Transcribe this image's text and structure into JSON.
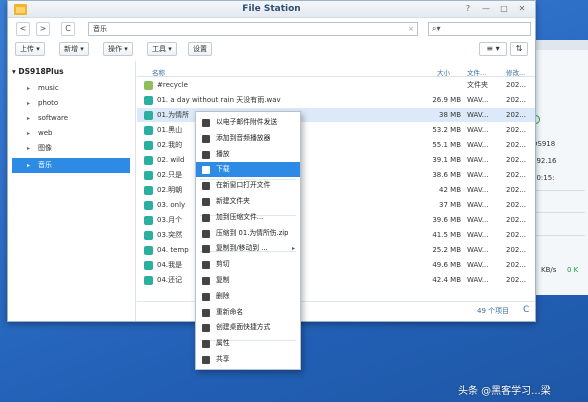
{
  "background_window": {
    "lines": [
      "DS918",
      "192.16",
      "00:15:",
      "KB/s",
      "0 K"
    ]
  },
  "window": {
    "title": "File Station",
    "controls": [
      "?",
      "—",
      "□",
      "✕"
    ]
  },
  "nav": {
    "back": "<",
    "forward": ">",
    "refresh": "C",
    "path": "音乐",
    "search_placeholder": "",
    "clear": "×"
  },
  "toolbar": {
    "upload": "上传 ▾",
    "new": "新增 ▾",
    "action": "操作 ▾",
    "tools": "工具 ▾",
    "settings": "设置",
    "view_list": "≡ ▾",
    "sort": "⇅"
  },
  "sidebar": {
    "root": "DS918Plus",
    "items": [
      {
        "label": "music",
        "arrow": "▸"
      },
      {
        "label": "photo",
        "arrow": "▸"
      },
      {
        "label": "software",
        "arrow": "▸"
      },
      {
        "label": "web",
        "arrow": "▸"
      },
      {
        "label": "图像",
        "arrow": "▸"
      },
      {
        "label": "音乐",
        "arrow": "▸"
      }
    ]
  },
  "list": {
    "columns": {
      "name": "名称",
      "size": "大小",
      "type": "文件...",
      "modified": "修改..."
    },
    "rows": [
      {
        "name": "#recycle",
        "size": "",
        "type": "文件夹",
        "modified": "202..."
      },
      {
        "name": "01. a day without rain 天没有雨.wav",
        "size": "26.9 MB",
        "type": "WAV...",
        "modified": "202..."
      },
      {
        "name": "01.为情所",
        "size": "38 MB",
        "type": "WAV...",
        "modified": "202..."
      },
      {
        "name": "01.黑山",
        "size": "53.2 MB",
        "type": "WAV...",
        "modified": "202..."
      },
      {
        "name": "02.我的",
        "size": "55.1 MB",
        "type": "WAV...",
        "modified": "202..."
      },
      {
        "name": "02. wild",
        "size": "39.1 MB",
        "type": "WAV...",
        "modified": "202..."
      },
      {
        "name": "02.只是",
        "size": "38.6 MB",
        "type": "WAV...",
        "modified": "202..."
      },
      {
        "name": "02.明朝",
        "size": "42 MB",
        "type": "WAV...",
        "modified": "202..."
      },
      {
        "name": "03. only",
        "size": "37 MB",
        "type": "WAV...",
        "modified": "202..."
      },
      {
        "name": "03.月个",
        "size": "39.6 MB",
        "type": "WAV...",
        "modified": "202..."
      },
      {
        "name": "03.突然",
        "size": "41.5 MB",
        "type": "WAV...",
        "modified": "202..."
      },
      {
        "name": "04. temp",
        "size": "25.2 MB",
        "type": "WAV...",
        "modified": "202..."
      },
      {
        "name": "04.我是",
        "size": "49.6 MB",
        "type": "WAV...",
        "modified": "202..."
      },
      {
        "name": "04.还记",
        "size": "42.4 MB",
        "type": "WAV...",
        "modified": "202..."
      }
    ],
    "count": "49 个项目",
    "refresh": "C"
  },
  "context_menu": {
    "items": [
      {
        "label": "以电子邮件附件发送",
        "icon": "mail-icon"
      },
      {
        "label": "添加到音频播放器",
        "icon": "add-to-player-icon"
      },
      {
        "label": "播放",
        "icon": "play-icon"
      },
      {
        "label": "下载",
        "icon": "download-icon",
        "highlighted": true
      },
      {
        "label": "在新窗口打开文件",
        "icon": "new-window-icon"
      },
      {
        "label": "新建文件夹",
        "icon": "new-folder-icon"
      },
      {
        "label": "加到压缩文件...",
        "icon": "archive-add-icon"
      },
      {
        "label": "压缩到 01.为情所伤.zip",
        "icon": "zip-icon"
      },
      {
        "label": "复制到/移动到 ...",
        "icon": "copy-move-icon",
        "submenu": "▸"
      },
      {
        "label": "剪切",
        "icon": "cut-icon"
      },
      {
        "label": "复制",
        "icon": "copy-icon"
      },
      {
        "label": "删除",
        "icon": "delete-icon"
      },
      {
        "label": "重新命名",
        "icon": "rename-icon"
      },
      {
        "label": "创建桌面快捷方式",
        "icon": "shortcut-icon"
      },
      {
        "label": "属性",
        "icon": "info-icon"
      },
      {
        "label": "共享",
        "icon": "share-icon"
      }
    ]
  },
  "watermark": "头条 @黑客学习...梁",
  "colors": {
    "accent": "#2d8be6",
    "desktop": "#2e6fc7",
    "title": "#2f4f73"
  }
}
